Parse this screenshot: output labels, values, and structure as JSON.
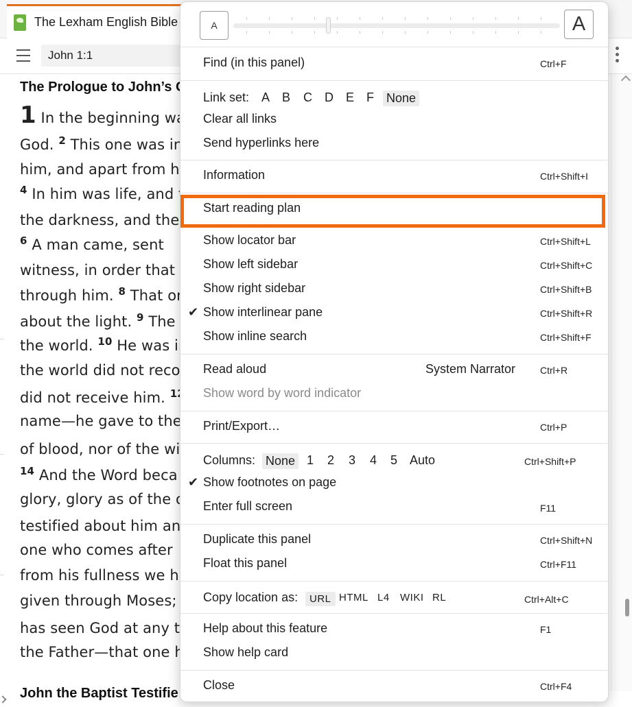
{
  "tab": {
    "title": "The Lexham English Bible"
  },
  "toolbar": {
    "reference": "John 1:1"
  },
  "document": {
    "heading": "The Prologue to John’s G",
    "lines": [
      {
        "pre": "",
        "verse": "1",
        "text": " In the beginning wa",
        "chapter": true
      },
      {
        "pre": "God. ",
        "verse": "2",
        "text": " This one was in"
      },
      {
        "pre": "him, and apart from hi",
        "verse": "",
        "text": ""
      },
      {
        "pre": "",
        "verse": "4",
        "text": " In him was life, and t"
      },
      {
        "pre": "the darkness, and the d",
        "verse": "",
        "text": ""
      },
      {
        "pre": "  ",
        "verse": "6",
        "text": " A man came, sent"
      },
      {
        "pre": "witness, in order that",
        "verse": "",
        "text": ""
      },
      {
        "pre": "through him. ",
        "verse": "8",
        "text": " That or"
      },
      {
        "pre": "about the light. ",
        "verse": "9",
        "text": " The"
      },
      {
        "pre": "the world. ",
        "verse": "10",
        "text": " He was in"
      },
      {
        "pre": "the world did not recog",
        "verse": "",
        "text": ""
      },
      {
        "pre": "did not receive him. ",
        "verse": "12",
        "text": ""
      },
      {
        "pre": "name—he gave to then",
        "verse": "",
        "text": ""
      },
      {
        "pre": "of blood, nor of the wil",
        "verse": "",
        "text": ""
      },
      {
        "pre": "",
        "verse": "14",
        "text": " And the Word beca"
      },
      {
        "pre": "glory, glory as of the o",
        "verse": "",
        "text": ""
      },
      {
        "pre": "testified about him and",
        "verse": "",
        "text": ""
      },
      {
        "pre": "one who comes after",
        "verse": "",
        "text": ""
      },
      {
        "pre": "from his fullness we h",
        "verse": "",
        "text": ""
      },
      {
        "pre": "given through Moses; g",
        "verse": "",
        "text": ""
      },
      {
        "pre": "has seen God at any ti",
        "verse": "",
        "text": ""
      },
      {
        "pre": "the Father—that one ha",
        "verse": "",
        "text": ""
      }
    ],
    "heading2": "John the Baptist Testifie"
  },
  "menu": {
    "font_small": "A",
    "font_large": "A",
    "find": {
      "label": "Find (in this panel)",
      "shortcut": "Ctrl+F"
    },
    "link_set": {
      "label": "Link set:",
      "options": [
        "A",
        "B",
        "C",
        "D",
        "E",
        "F",
        "None"
      ],
      "selected": "None"
    },
    "clear_links": "Clear all links",
    "send_hyperlinks": "Send hyperlinks here",
    "information": {
      "label": "Information",
      "shortcut": "Ctrl+Shift+I"
    },
    "start_reading_plan": "Start reading plan",
    "locator_bar": {
      "label": "Show locator bar",
      "shortcut": "Ctrl+Shift+L"
    },
    "left_sidebar": {
      "label": "Show left sidebar",
      "shortcut": "Ctrl+Shift+C"
    },
    "right_sidebar": {
      "label": "Show right sidebar",
      "shortcut": "Ctrl+Shift+B"
    },
    "interlinear": {
      "label": "Show interlinear pane",
      "shortcut": "Ctrl+Shift+R",
      "checked": true
    },
    "inline_search": {
      "label": "Show inline search",
      "shortcut": "Ctrl+Shift+F"
    },
    "read_aloud": {
      "label": "Read aloud",
      "voice": "System Narrator",
      "shortcut": "Ctrl+R"
    },
    "word_indicator": "Show word by word indicator",
    "print_export": {
      "label": "Print/Export…",
      "shortcut": "Ctrl+P"
    },
    "columns": {
      "label": "Columns:",
      "options": [
        "None",
        "1",
        "2",
        "3",
        "4",
        "5",
        "Auto"
      ],
      "selected": "None",
      "shortcut": "Ctrl+Shift+P"
    },
    "footnotes": {
      "label": "Show footnotes on page",
      "checked": true
    },
    "full_screen": {
      "label": "Enter full screen",
      "shortcut": "F11"
    },
    "duplicate": {
      "label": "Duplicate this panel",
      "shortcut": "Ctrl+Shift+N"
    },
    "float": {
      "label": "Float this panel",
      "shortcut": "Ctrl+F11"
    },
    "copy_location": {
      "label": "Copy location as:",
      "options": [
        "URL",
        "HTML",
        "L4",
        "WIKI",
        "RL"
      ],
      "selected": "URL",
      "shortcut": "Ctrl+Alt+C"
    },
    "help_feature": {
      "label": "Help about this feature",
      "shortcut": "F1"
    },
    "help_card": "Show help card",
    "close": {
      "label": "Close",
      "shortcut": "Ctrl+F4"
    }
  },
  "colors": {
    "accent": "#f06a10",
    "app_icon": "#6db33f"
  },
  "icons": [
    "app-book-icon",
    "hamburger-icon",
    "kebab-icon",
    "checkmark-icon",
    "scroll-up-icon"
  ]
}
